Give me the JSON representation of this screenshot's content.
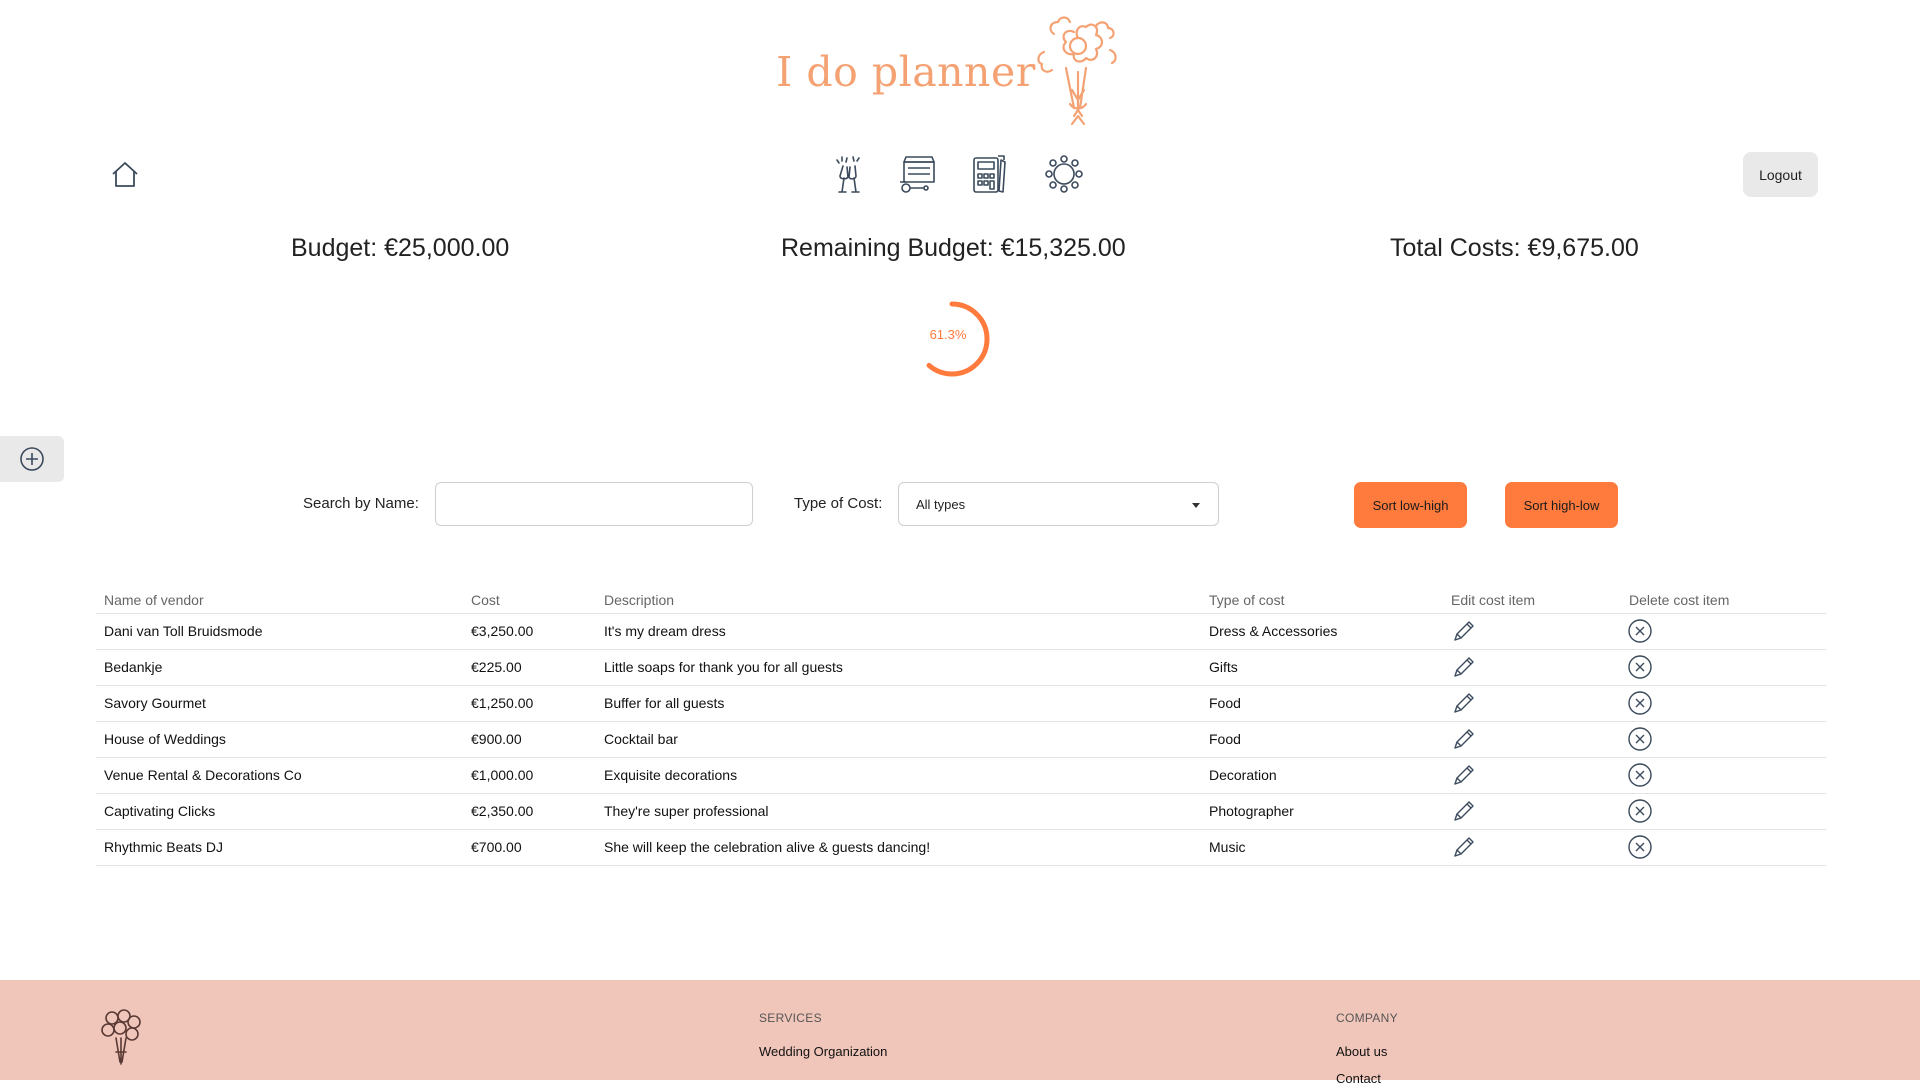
{
  "header": {
    "title": "I do planner",
    "logo_icon": "flower-bouquet-icon",
    "home_icon": "home-icon",
    "nav_icons": [
      "champagne-toast-icon",
      "cart-food-icon",
      "budget-calculator-icon",
      "seating-table-icon"
    ],
    "logout_label": "Logout"
  },
  "summary": {
    "budget": "Budget: €25,000.00",
    "remaining": "Remaining Budget: €15,325.00",
    "total": "Total Costs: €9,675.00",
    "progress_label": "61.3%",
    "progress_fraction": 0.613
  },
  "side_tab": {
    "icon": "add-circle-icon"
  },
  "filters": {
    "search_label": "Search by Name:",
    "search_value": "",
    "type_label": "Type of Cost:",
    "type_value": "All types",
    "sort_low_high": "Sort low-high",
    "sort_high_low": "Sort high-low"
  },
  "table": {
    "headers": [
      "Name of vendor",
      "Cost",
      "Description",
      "Type of cost",
      "Edit cost item",
      "Delete cost item"
    ],
    "rows": [
      {
        "vendor": "Dani van Toll Bruidsmode",
        "cost": "€3,250.00",
        "description": "It's my dream dress",
        "type": "Dress & Accessories"
      },
      {
        "vendor": "Bedankje",
        "cost": "€225.00",
        "description": "Little soaps for thank you for all guests",
        "type": "Gifts"
      },
      {
        "vendor": "Savory Gourmet",
        "cost": "€1,250.00",
        "description": "Buffer for all guests",
        "type": "Food"
      },
      {
        "vendor": "House of Weddings",
        "cost": "€900.00",
        "description": "Cocktail bar",
        "type": "Food"
      },
      {
        "vendor": "Venue Rental & Decorations Co",
        "cost": "€1,000.00",
        "description": "Exquisite decorations",
        "type": "Decoration"
      },
      {
        "vendor": "Captivating Clicks",
        "cost": "€2,350.00",
        "description": "They're super professional",
        "type": "Photographer"
      },
      {
        "vendor": "Rhythmic Beats DJ",
        "cost": "€700.00",
        "description": "She will keep the celebration alive & guests dancing!",
        "type": "Music"
      }
    ],
    "edit_icon": "pencil-icon",
    "delete_icon": "close-circle-icon"
  },
  "footer": {
    "services_heading": "SERVICES",
    "services_link": "Wedding Organization",
    "company_heading": "COMPANY",
    "company_links": [
      "About us",
      "Contact"
    ]
  },
  "colors": {
    "accent": "#ff7a3d",
    "brand": "#f4a273",
    "footer_bg": "#f1c6ba",
    "icon_stroke": "#3b4a5c"
  }
}
